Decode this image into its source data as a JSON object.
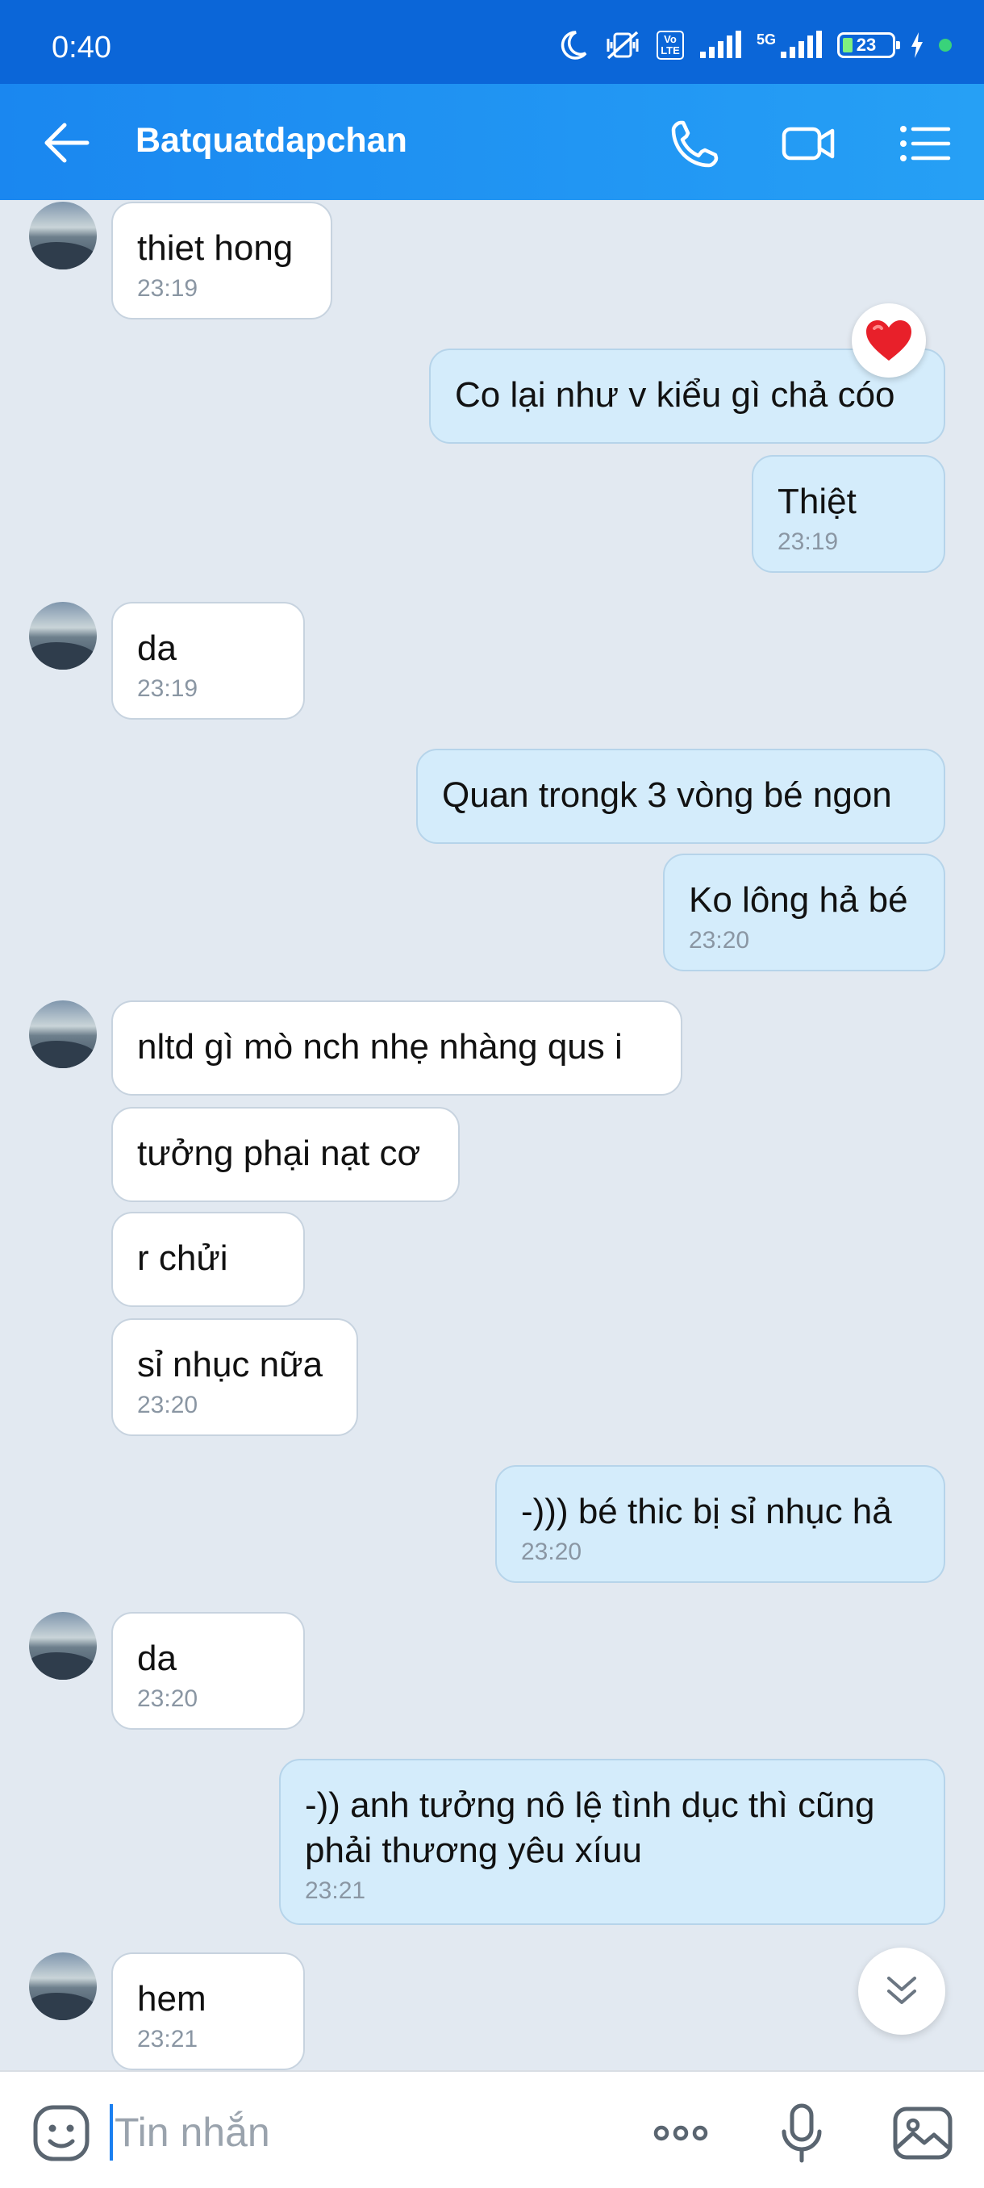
{
  "status_bar": {
    "time": "0:40",
    "battery": "23",
    "network": "5G",
    "volte": "Vo LTE"
  },
  "header": {
    "title": "Batquatdapchan",
    "back_icon": "arrow-left-icon",
    "call_icon": "phone-icon",
    "video_icon": "video-camera-icon",
    "menu_icon": "list-menu-icon"
  },
  "messages": [
    {
      "side": "in",
      "text": "thiet hong",
      "time": "23:19"
    },
    {
      "side": "out",
      "text": "Co lại như v kiểu gì chả cóo",
      "time": "",
      "reaction": "heart"
    },
    {
      "side": "out",
      "text": "Thiệt",
      "time": "23:19"
    },
    {
      "side": "in",
      "text": "da",
      "time": "23:19"
    },
    {
      "side": "out",
      "text": "Quan trongk 3 vòng bé ngon",
      "time": ""
    },
    {
      "side": "out",
      "text": "Ko lông hả bé",
      "time": "23:20"
    },
    {
      "side": "in",
      "text": "nltd gì mò nch nhẹ nhàng qus i",
      "time": ""
    },
    {
      "side": "in",
      "text": "tưởng phại nạt cơ",
      "time": ""
    },
    {
      "side": "in",
      "text": "r chửi",
      "time": ""
    },
    {
      "side": "in",
      "text": "sỉ nhục nữa",
      "time": "23:20"
    },
    {
      "side": "out",
      "text": "-))) bé thic bị sỉ nhục hả",
      "time": "23:20"
    },
    {
      "side": "in",
      "text": "da",
      "time": "23:20"
    },
    {
      "side": "out",
      "text": "-)) anh tưởng nô lệ tình dục thì cũng phải thương yêu xíuu",
      "time": "23:21"
    },
    {
      "side": "in",
      "text": "hem",
      "time": "23:21"
    }
  ],
  "composer": {
    "placeholder": "Tin nhắn",
    "sticker_icon": "sticker-smile-icon",
    "more_icon": "more-dots-icon",
    "mic_icon": "microphone-icon",
    "image_icon": "image-icon"
  },
  "colors": {
    "header": "#1a87f0",
    "status_bar": "#0b66d8",
    "chat_bg": "#e2e9f1",
    "bubble_out": "#d4ecfb",
    "bubble_in": "#ffffff"
  }
}
